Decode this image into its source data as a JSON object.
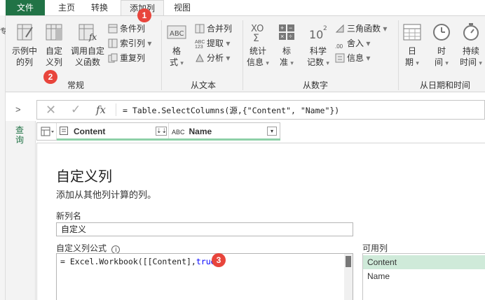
{
  "tabs": {
    "file": "文件",
    "home": "主页",
    "transform": "转换",
    "add_column": "添加列",
    "view": "视图"
  },
  "left_strip": {
    "frag1": "专",
    "frag2": ""
  },
  "ribbon": {
    "general": {
      "label": "常规",
      "example_column": [
        "示例中",
        "的列"
      ],
      "custom_column": [
        "自定",
        "义列"
      ],
      "invoke_function": [
        "调用自定",
        "义函数"
      ],
      "conditional_column": "条件列",
      "index_column": "索引列",
      "duplicate_column": "重复列"
    },
    "from_text": {
      "label": "从文本",
      "format": [
        "格",
        "式"
      ],
      "merge_columns": "合并列",
      "extract": "提取",
      "parse": "分析",
      "abc_icon": "ABC"
    },
    "from_number": {
      "label": "从数字",
      "statistics": [
        "统计",
        "信息"
      ],
      "standard": [
        "标",
        "准"
      ],
      "scientific": [
        "科学",
        "记数"
      ],
      "trigonometry": "三角函数",
      "rounding": "舍入",
      "information": "信息",
      "sci_icon": "10",
      "sci_sup": "2"
    },
    "from_datetime": {
      "label": "从日期和时间",
      "date": [
        "日",
        "期"
      ],
      "time": [
        "时",
        "间"
      ],
      "duration": [
        "持续",
        "时间"
      ]
    }
  },
  "badges": {
    "b1": "1",
    "b2": "2",
    "b3": "3"
  },
  "formula_bar": {
    "fx": "fx",
    "text": "= Table.SelectColumns(源,{\"Content\", \"Name\"})"
  },
  "left_nav": {
    "label": "查询"
  },
  "grid": {
    "col1": "Content",
    "col2": "Name",
    "col2_type": "ABC"
  },
  "dialog": {
    "title": "自定义列",
    "subtitle": "添加从其他列计算的列。",
    "new_col_label": "新列名",
    "new_col_value": "自定义",
    "formula_label": "自定义列公式",
    "formula_prefix": "= Excel.Workbook([[Content],",
    "formula_kw": "true",
    "formula_suffix": ")",
    "available_label": "可用列",
    "available": [
      "Content",
      "Name"
    ]
  },
  "colors": {
    "accent": "#217346",
    "badge": "#e8453c",
    "selected": "#cfead9"
  }
}
